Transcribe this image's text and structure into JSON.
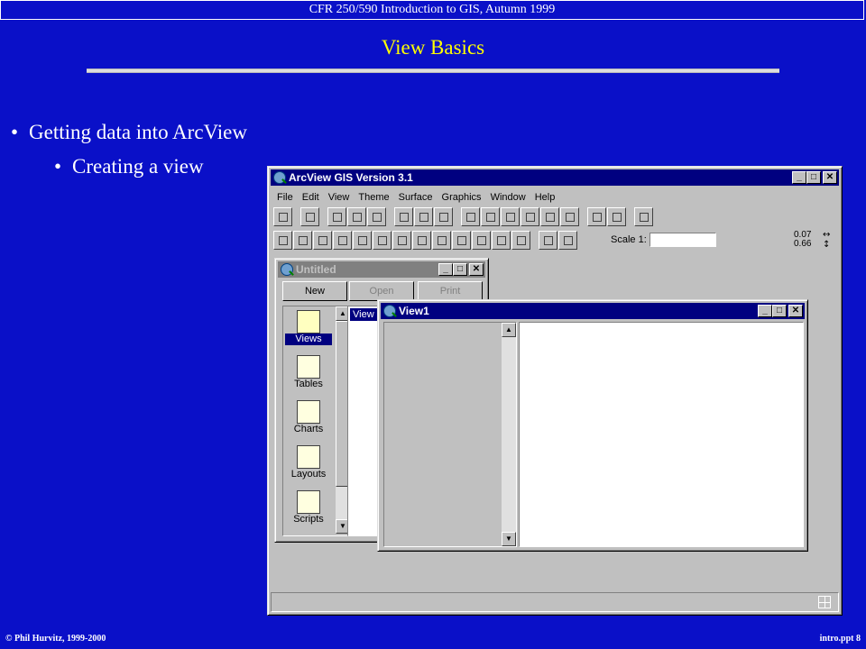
{
  "slide": {
    "header": "CFR 250/590 Introduction to GIS, Autumn 1999",
    "title": "View Basics",
    "bullet1": "Getting data into ArcView",
    "bullet2": "Creating a view",
    "footer_left": "© Phil Hurvitz, 1999-2000",
    "footer_right": "intro.ppt 8",
    "bullet_char": "•"
  },
  "app": {
    "title": "ArcView GIS Version 3.1",
    "menu": [
      "File",
      "Edit",
      "View",
      "Theme",
      "Surface",
      "Graphics",
      "Window",
      "Help"
    ],
    "scale_label": "Scale 1:",
    "coord_x": "0.07",
    "coord_y": "0.66",
    "window_buttons": {
      "minimize": "_",
      "maximize": "□",
      "close": "✕"
    }
  },
  "project_window": {
    "title": "Untitled",
    "buttons": [
      "New",
      "Open",
      "Print"
    ],
    "doc_types": [
      "Views",
      "Tables",
      "Charts",
      "Layouts",
      "Scripts"
    ],
    "selected_doc_type": "Views",
    "list_item": "View"
  },
  "view_window": {
    "title": "View1"
  },
  "colors": {
    "slide_bg": "#0a10c8",
    "title_yellow": "#ffff00",
    "active_title": "#000080",
    "inactive_title": "#808080",
    "win_face": "#c0c0c0"
  }
}
